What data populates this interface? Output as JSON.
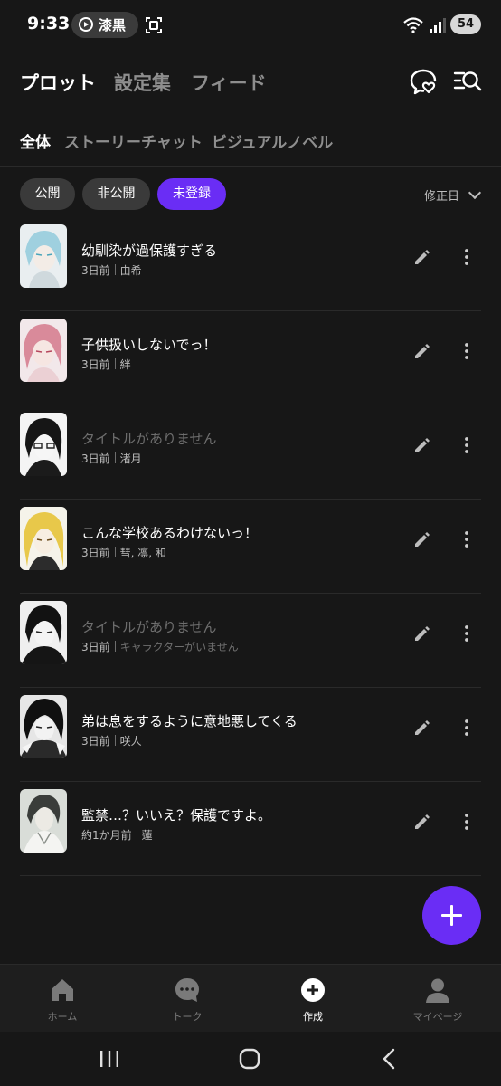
{
  "status_bar": {
    "time": "9:33",
    "app_pill_label": "漆黒",
    "battery": "54",
    "wifi_badge": "6"
  },
  "header": {
    "tabs": [
      "プロット",
      "設定集",
      "フィード"
    ],
    "active_tab": "プロット",
    "icons": [
      "chat-heart-icon",
      "search-list-icon"
    ]
  },
  "sub_tabs": {
    "items": [
      "全体",
      "ストーリーチャット",
      "ビジュアルノベル"
    ],
    "active": "全体"
  },
  "filters": {
    "chips": [
      "公開",
      "非公開",
      "未登録"
    ],
    "active": "未登録",
    "sort_label": "修正日"
  },
  "stories": [
    {
      "title": "幼馴染が過保護すぎる",
      "time": "3日前",
      "characters": "由希",
      "title_placeholder": false,
      "characters_muted": false
    },
    {
      "title": "子供扱いしないでっ！",
      "time": "3日前",
      "characters": "絆",
      "title_placeholder": false,
      "characters_muted": false
    },
    {
      "title": "タイトルがありません",
      "time": "3日前",
      "characters": "渚月",
      "title_placeholder": true,
      "characters_muted": false
    },
    {
      "title": "こんな学校あるわけないっ！",
      "time": "3日前",
      "characters": "彗, 凛, 和",
      "title_placeholder": false,
      "characters_muted": false
    },
    {
      "title": "タイトルがありません",
      "time": "3日前",
      "characters": "キャラクターがいません",
      "title_placeholder": true,
      "characters_muted": true
    },
    {
      "title": "弟は息をするように意地悪してくる",
      "time": "3日前",
      "characters": "咲人",
      "title_placeholder": false,
      "characters_muted": false
    },
    {
      "title": "監禁…？いいえ？保護ですよ。",
      "time": "約1か月前",
      "characters": "蓮",
      "title_placeholder": false,
      "characters_muted": false
    }
  ],
  "bottom_nav": {
    "items": [
      "ホーム",
      "トーク",
      "作成",
      "マイページ"
    ],
    "active": "作成"
  },
  "colors": {
    "background": "#171717",
    "accent": "#6a2df5",
    "chip": "#3a3a3a",
    "text_muted": "#8e8e8e"
  }
}
